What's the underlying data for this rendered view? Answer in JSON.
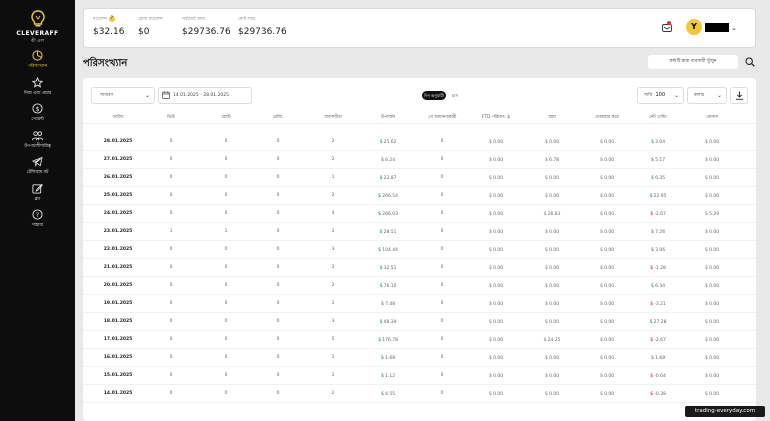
{
  "sidebar": {
    "logo_name": "CLEVERAFF",
    "logo_sub": "কী এল",
    "items": [
      {
        "label": "পরিসংখ্যান",
        "icon": "stats-icon",
        "active": true
      },
      {
        "label": "নিজ এবং প্রচার",
        "icon": "star-icon",
        "active": false
      },
      {
        "label": "পেমেন্ট",
        "icon": "dollar-icon",
        "active": false
      },
      {
        "label": "টপ-অংশীদারিত্ব",
        "icon": "users-icon",
        "active": false
      },
      {
        "label": "টেলিগ্রাম বট",
        "icon": "telegram-icon",
        "active": false
      },
      {
        "label": "ব্লগ",
        "icon": "edit-icon",
        "active": false
      },
      {
        "label": "সাহায্য",
        "icon": "help-icon",
        "active": false
      }
    ]
  },
  "topbar": {
    "stats": [
      {
        "label": "ব্যালেন্স",
        "value": "$32.16",
        "has_help": true,
        "help": "?"
      },
      {
        "label": "হোল্ড ব্যালেন্স",
        "value": "$0",
        "has_help": false
      },
      {
        "label": "সর্বমোট আয়",
        "value": "$29736.76",
        "has_help": false
      },
      {
        "label": "মোট লাভ",
        "value": "$29736.76",
        "has_help": false
      }
    ],
    "avatar_letter": "Y",
    "chevron": "⌄"
  },
  "page": {
    "title": "পরিসংখ্যান",
    "search_button": "কমিটি দ্বারা ব্যবসায়ী খুঁজুন"
  },
  "filters": {
    "select_label": "সাধারণ",
    "date_range": "14.01.2025 - 28.01.2025",
    "toggle_on": "দিন অনুযায়ী",
    "toggle_off": "মাস",
    "rows_label": "সারি",
    "rows_value": "100",
    "columns_label": "কলাম"
  },
  "table": {
    "headers": [
      "তারিখ",
      "ভিউ",
      "হোস্ট",
      "রেজি.",
      "ব্যবসায়ীরা",
      "উপার্জন",
      "১ম আমানতকারী",
      "FTD পরিমাণ, $",
      "জমা",
      "প্রত্যাহার করে",
      "নেট গেমিং",
      "বোনাস"
    ],
    "rows": [
      {
        "date": "28.01.2025",
        "views": "0",
        "hosts": "0",
        "regs": "0",
        "traders": "2",
        "earn": "25.62",
        "earn_sign": "g",
        "first": "0",
        "ftd": "0.00",
        "dep": "0.00",
        "wd": "0.00",
        "net": "3.04",
        "net_sign": "g",
        "bonus": "0.00"
      },
      {
        "date": "27.01.2025",
        "views": "0",
        "hosts": "0",
        "regs": "0",
        "traders": "2",
        "earn": "6.24",
        "earn_sign": "g",
        "first": "0",
        "ftd": "0.00",
        "dep": "6.78",
        "wd": "0.00",
        "net": "5.17",
        "net_sign": "g",
        "bonus": "0.00"
      },
      {
        "date": "26.01.2025",
        "views": "0",
        "hosts": "0",
        "regs": "0",
        "traders": "1",
        "earn": "22.87",
        "earn_sign": "g",
        "first": "0",
        "ftd": "0.00",
        "dep": "0.00",
        "wd": "0.00",
        "net": "6.35",
        "net_sign": "g",
        "bonus": "0.00"
      },
      {
        "date": "25.01.2025",
        "views": "0",
        "hosts": "0",
        "regs": "0",
        "traders": "2",
        "earn": "266.54",
        "earn_sign": "g",
        "first": "0",
        "ftd": "0.00",
        "dep": "0.00",
        "wd": "0.00",
        "net": "22.95",
        "net_sign": "g",
        "bonus": "0.00"
      },
      {
        "date": "24.01.2025",
        "views": "0",
        "hosts": "0",
        "regs": "0",
        "traders": "4",
        "earn": "266.03",
        "earn_sign": "g",
        "first": "0",
        "ftd": "0.00",
        "dep": "26.83",
        "wd": "0.00",
        "net": "-2.67",
        "net_sign": "r",
        "bonus": "5.29"
      },
      {
        "date": "23.01.2025",
        "views": "1",
        "hosts": "1",
        "regs": "0",
        "traders": "3",
        "earn": "28.51",
        "earn_sign": "g",
        "first": "0",
        "ftd": "0.00",
        "dep": "0.00",
        "wd": "0.00",
        "net": "7.26",
        "net_sign": "g",
        "bonus": "0.00"
      },
      {
        "date": "22.01.2025",
        "views": "0",
        "hosts": "0",
        "regs": "0",
        "traders": "3",
        "earn": "104.44",
        "earn_sign": "g",
        "first": "0",
        "ftd": "0.00",
        "dep": "0.00",
        "wd": "0.00",
        "net": "3.06",
        "net_sign": "g",
        "bonus": "0.00"
      },
      {
        "date": "21.01.2025",
        "views": "0",
        "hosts": "0",
        "regs": "0",
        "traders": "3",
        "earn": "32.51",
        "earn_sign": "g",
        "first": "0",
        "ftd": "0.00",
        "dep": "0.00",
        "wd": "0.00",
        "net": "-1.28",
        "net_sign": "r",
        "bonus": "0.00"
      },
      {
        "date": "20.01.2025",
        "views": "0",
        "hosts": "0",
        "regs": "0",
        "traders": "2",
        "earn": "76.10",
        "earn_sign": "g",
        "first": "0",
        "ftd": "0.00",
        "dep": "0.00",
        "wd": "0.00",
        "net": "6.34",
        "net_sign": "g",
        "bonus": "0.00"
      },
      {
        "date": "19.01.2025",
        "views": "0",
        "hosts": "0",
        "regs": "0",
        "traders": "1",
        "earn": "7.48",
        "earn_sign": "g",
        "first": "0",
        "ftd": "0.00",
        "dep": "0.00",
        "wd": "0.00",
        "net": "-3.21",
        "net_sign": "r",
        "bonus": "0.00"
      },
      {
        "date": "18.01.2025",
        "views": "0",
        "hosts": "0",
        "regs": "0",
        "traders": "3",
        "earn": "48.39",
        "earn_sign": "g",
        "first": "0",
        "ftd": "0.00",
        "dep": "0.00",
        "wd": "0.00",
        "net": "27.28",
        "net_sign": "g",
        "bonus": "0.00"
      },
      {
        "date": "17.01.2025",
        "views": "0",
        "hosts": "0",
        "regs": "0",
        "traders": "5",
        "earn": "176.78",
        "earn_sign": "g",
        "first": "0",
        "ftd": "0.00",
        "dep": "24.25",
        "wd": "0.00",
        "net": "-2.67",
        "net_sign": "r",
        "bonus": "0.00"
      },
      {
        "date": "16.01.2025",
        "views": "0",
        "hosts": "0",
        "regs": "0",
        "traders": "1",
        "earn": "1.68",
        "earn_sign": "g",
        "first": "0",
        "ftd": "0.00",
        "dep": "0.00",
        "wd": "0.00",
        "net": "1.68",
        "net_sign": "g",
        "bonus": "0.00"
      },
      {
        "date": "15.01.2025",
        "views": "0",
        "hosts": "0",
        "regs": "0",
        "traders": "1",
        "earn": "1.12",
        "earn_sign": "g",
        "first": "0",
        "ftd": "0.00",
        "dep": "0.00",
        "wd": "0.00",
        "net": "-0.64",
        "net_sign": "r",
        "bonus": "0.00"
      },
      {
        "date": "14.01.2025",
        "views": "0",
        "hosts": "0",
        "regs": "0",
        "traders": "2",
        "earn": "4.55",
        "earn_sign": "g",
        "first": "0",
        "ftd": "0.00",
        "dep": "0.00",
        "wd": "0.00",
        "net": "-0.38",
        "net_sign": "r",
        "bonus": "0.00"
      }
    ]
  },
  "watermark": "trading-everyday.com",
  "colors": {
    "accent": "#f3c73a",
    "positive": "#2e9e44",
    "negative": "#d93025",
    "sidebar_bg": "#0d0d0d"
  }
}
